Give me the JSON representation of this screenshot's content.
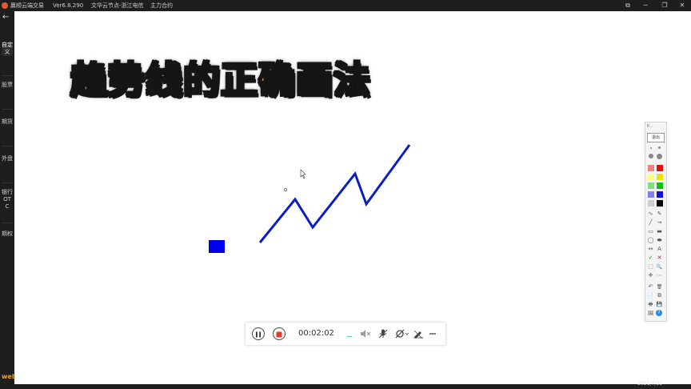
{
  "window": {
    "app_title": "赢顺云端交易",
    "version": "Ver6.8.290",
    "node": "文华云节点-浙江电信",
    "contract": "主力合约",
    "controls": [
      "⧉",
      "─",
      "❐",
      "✕"
    ]
  },
  "sidebar": {
    "items": [
      {
        "label": "自定义"
      },
      {
        "label": "股票"
      },
      {
        "label": "期货"
      },
      {
        "label": "外盘"
      },
      {
        "label": "银行OTC"
      },
      {
        "label": "期权"
      }
    ],
    "brand": "web"
  },
  "canvas": {
    "headline": "趋势线的正确画法",
    "colors": {
      "line": "#0a1ec8",
      "marker": "#0000ee",
      "headline": "#f7e11b",
      "outline": "#151515"
    }
  },
  "toolbox": {
    "label": "P...",
    "exit_label": "退出",
    "colors": [
      "#f08080",
      "#e01010",
      "#ffff80",
      "#f0e000",
      "#80e080",
      "#10c010",
      "#8080f0",
      "#1010e0",
      "#cccccc",
      "#000000"
    ],
    "tools": [
      "∿",
      "✎",
      "╱",
      "→",
      "▭",
      "▬",
      "◯",
      "⬬",
      "↔",
      "A",
      "✓",
      "✕",
      "⬚",
      "🔍",
      "✚",
      "⋯",
      "↶",
      "🗑",
      "📄",
      "⧉",
      "🖶",
      "💾",
      "🖼",
      "?"
    ]
  },
  "recorder": {
    "elapsed": "00:02:02",
    "icons": [
      "pause-icon",
      "stop-icon",
      "volume-muted-icon",
      "microphone-icon",
      "camera-off-icon",
      "pen-off-icon",
      "minimize-icon"
    ]
  },
  "status": {
    "date": "2021/7/31"
  }
}
